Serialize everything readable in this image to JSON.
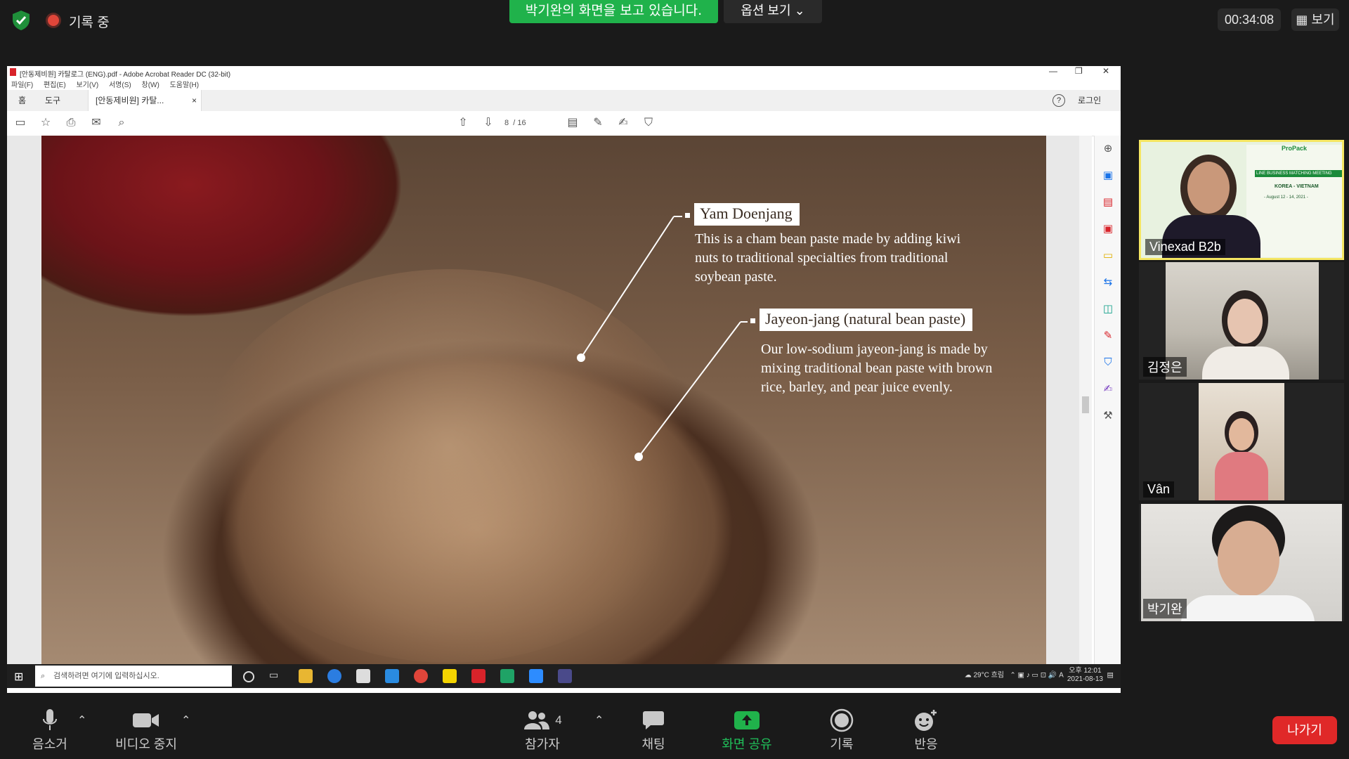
{
  "topbar": {
    "recording_label": "기록 중",
    "viewing_banner": "박기완의 화면을 보고 있습니다.",
    "view_options": "옵션 보기",
    "timer": "00:34:08",
    "view_button": "보기"
  },
  "acrobat": {
    "title": "[안동제비원] 카탈로그 (ENG).pdf - Adobe Acrobat Reader DC (32-bit)",
    "menu": [
      "파일(F)",
      "편집(E)",
      "보기(V)",
      "서명(S)",
      "창(W)",
      "도움말(H)"
    ],
    "tabs": [
      "홈",
      "도구",
      "[안동제비원] 카탈..."
    ],
    "login": "로그인",
    "page_current": "8",
    "page_total": "/ 16"
  },
  "page_content": {
    "callout1_title": "Yam Doenjang",
    "callout1_body": "This is a cham bean paste made by adding kiwi nuts to traditional specialties from traditional soybean paste.",
    "callout2_title": "Jayeon-jang (natural bean paste)",
    "callout2_body": "Our low-sodium jayeon-jang is made by mixing traditional bean paste with brown rice, barley, and pear juice evenly."
  },
  "taskbar": {
    "search_placeholder": "검색하려면 여기에 입력하십시오.",
    "weather": "29°C 흐림",
    "time": "오후 12:01",
    "date": "2021-08-13"
  },
  "participants": [
    {
      "name": "Vinexad B2b",
      "active": true
    },
    {
      "name": "김정은"
    },
    {
      "name": "Vân"
    },
    {
      "name": "박기완"
    }
  ],
  "vinexad_banner": {
    "brand": "ProPack",
    "headline": "LINE BUSINESS MATCHING MEETING",
    "sub": "KOREA - VIETNAM",
    "dates": "- August 12 - 14, 2021 -"
  },
  "controls": {
    "audio": "음소거",
    "video": "비디오 중지",
    "participants": "참가자",
    "participants_count": "4",
    "chat": "채팅",
    "share": "화면 공유",
    "record": "기록",
    "reactions": "반응",
    "leave": "나가기"
  },
  "colors": {
    "share_green": "#20b24b",
    "leave_red": "#e02828",
    "active_border": "#f5e663"
  }
}
